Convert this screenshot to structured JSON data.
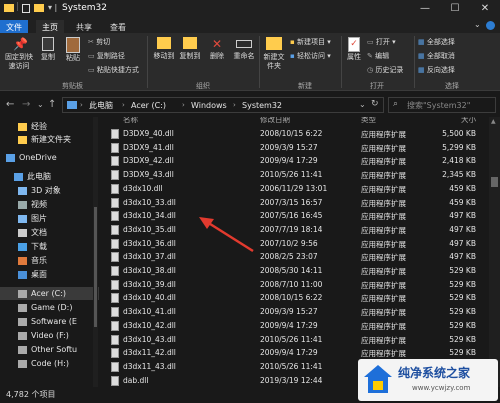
{
  "window": {
    "title": "System32",
    "minimize": "—",
    "maximize": "☐",
    "close": "✕"
  },
  "tabs": [
    "文件",
    "主页",
    "共享",
    "查看"
  ],
  "ribbon": {
    "pin": "固定到快速访问",
    "copy": "复制",
    "paste": "粘贴",
    "cut": "剪切",
    "copy_path": "复制路径",
    "paste_shortcut": "粘贴快捷方式",
    "clipboard_group": "剪贴板",
    "move_to": "移动到",
    "copy_to": "复制到",
    "delete": "删除",
    "rename": "重命名",
    "new_folder": "新建文件夹",
    "new_item": "新建项目",
    "easy_access": "轻松访问",
    "properties": "属性",
    "open": "打开",
    "edit": "编辑",
    "history": "历史记录",
    "select_all": "全部选择",
    "select_none": "全部取消",
    "invert_selection": "反向选择",
    "organize_group": "组织",
    "new_group": "新建",
    "open_group": "打开",
    "select_group": "选择"
  },
  "address": {
    "crumbs": [
      "此电脑",
      "Acer (C:)",
      "Windows",
      "System32"
    ],
    "search_placeholder": "搜索\"System32\""
  },
  "sidebar": [
    {
      "label": "经验",
      "icon": "folder-icon"
    },
    {
      "label": "新建文件夹",
      "icon": "folder-icon"
    },
    {
      "label": "OneDrive",
      "icon": "cloud-icon"
    },
    {
      "label": "此电脑",
      "icon": "pc-icon"
    },
    {
      "label": "3D 对象",
      "icon": "cube-icon"
    },
    {
      "label": "视频",
      "icon": "video-icon"
    },
    {
      "label": "图片",
      "icon": "picture-icon"
    },
    {
      "label": "文档",
      "icon": "document-icon"
    },
    {
      "label": "下载",
      "icon": "download-icon"
    },
    {
      "label": "音乐",
      "icon": "music-icon"
    },
    {
      "label": "桌面",
      "icon": "desktop-icon"
    },
    {
      "label": "Acer (C:)",
      "icon": "drive-icon"
    },
    {
      "label": "Game (D:)",
      "icon": "drive-icon"
    },
    {
      "label": "Software (E",
      "icon": "drive-icon"
    },
    {
      "label": "Video (F:)",
      "icon": "drive-icon"
    },
    {
      "label": "Other Softu",
      "icon": "drive-icon"
    },
    {
      "label": "Code (H:)",
      "icon": "drive-icon"
    }
  ],
  "columns": {
    "name": "名称",
    "date": "修改日期",
    "type": "类型",
    "size": "大小"
  },
  "files": [
    {
      "name": "D3DX9_40.dll",
      "date": "2008/10/15 6:22",
      "type": "应用程序扩展",
      "size": "5,500 KB"
    },
    {
      "name": "D3DX9_41.dll",
      "date": "2009/3/9 15:27",
      "type": "应用程序扩展",
      "size": "5,299 KB"
    },
    {
      "name": "D3DX9_42.dll",
      "date": "2009/9/4 17:29",
      "type": "应用程序扩展",
      "size": "2,418 KB"
    },
    {
      "name": "D3DX9_43.dll",
      "date": "2010/5/26 11:41",
      "type": "应用程序扩展",
      "size": "2,345 KB"
    },
    {
      "name": "d3dx10.dll",
      "date": "2006/11/29 13:01",
      "type": "应用程序扩展",
      "size": "459 KB"
    },
    {
      "name": "d3dx10_33.dll",
      "date": "2007/3/15 16:57",
      "type": "应用程序扩展",
      "size": "459 KB"
    },
    {
      "name": "d3dx10_34.dll",
      "date": "2007/5/16 16:45",
      "type": "应用程序扩展",
      "size": "497 KB"
    },
    {
      "name": "d3dx10_35.dll",
      "date": "2007/7/19 18:14",
      "type": "应用程序扩展",
      "size": "497 KB"
    },
    {
      "name": "d3dx10_36.dll",
      "date": "2007/10/2 9:56",
      "type": "应用程序扩展",
      "size": "497 KB"
    },
    {
      "name": "d3dx10_37.dll",
      "date": "2008/2/5 23:07",
      "type": "应用程序扩展",
      "size": "497 KB"
    },
    {
      "name": "d3dx10_38.dll",
      "date": "2008/5/30 14:11",
      "type": "应用程序扩展",
      "size": "529 KB"
    },
    {
      "name": "d3dx10_39.dll",
      "date": "2008/7/10 11:00",
      "type": "应用程序扩展",
      "size": "529 KB"
    },
    {
      "name": "d3dx10_40.dll",
      "date": "2008/10/15 6:22",
      "type": "应用程序扩展",
      "size": "529 KB"
    },
    {
      "name": "d3dx10_41.dll",
      "date": "2009/3/9 15:27",
      "type": "应用程序扩展",
      "size": "529 KB"
    },
    {
      "name": "d3dx10_42.dll",
      "date": "2009/9/4 17:29",
      "type": "应用程序扩展",
      "size": "529 KB"
    },
    {
      "name": "d3dx10_43.dll",
      "date": "2010/5/26 11:41",
      "type": "应用程序扩展",
      "size": "529 KB"
    },
    {
      "name": "d3dx11_42.dll",
      "date": "2009/9/4 17:29",
      "type": "应用程序扩展",
      "size": "529 KB"
    },
    {
      "name": "d3dx11_43.dll",
      "date": "2010/5/26 11:41",
      "type": "应用程序扩展",
      "size": "529 KB"
    },
    {
      "name": "dab.dll",
      "date": "2019/3/19 12:44",
      "type": "应用程序扩展",
      "size": "529 KB"
    }
  ],
  "status": {
    "count": "4,782 个项目"
  },
  "watermark": {
    "brand": "纯净系统之家",
    "url": "www.ycwjzy.com"
  },
  "colors": {
    "accent": "#ffcc4d",
    "selection": "#3a3a3a",
    "arrow": "#e23a2e"
  }
}
